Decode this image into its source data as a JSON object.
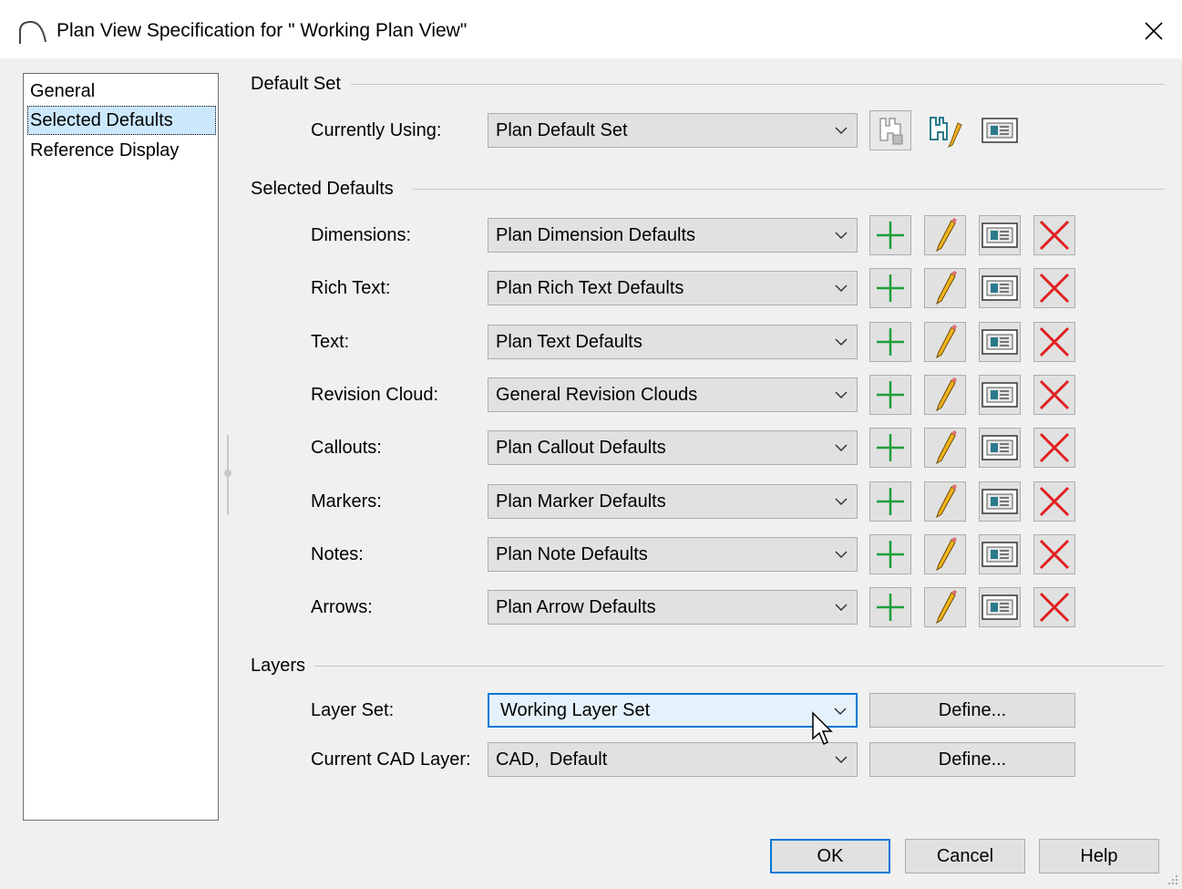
{
  "window": {
    "title": "Plan View Specification for \" Working Plan View\""
  },
  "nav": {
    "items": [
      {
        "label": "General"
      },
      {
        "label": "Selected Defaults"
      },
      {
        "label": "Reference Display"
      }
    ],
    "selected": "Selected Defaults"
  },
  "default_set": {
    "section_title": "Default Set",
    "label": "Currently Using:",
    "value": "Plan Default Set"
  },
  "selected_defaults": {
    "section_title": "Selected Defaults",
    "rows": [
      {
        "label": "Dimensions:",
        "value": "Plan Dimension Defaults"
      },
      {
        "label": "Rich Text:",
        "value": "Plan Rich Text Defaults"
      },
      {
        "label": "Text:",
        "value": "Plan Text Defaults"
      },
      {
        "label": "Revision Cloud:",
        "value": "General Revision Clouds"
      },
      {
        "label": "Callouts:",
        "value": "Plan Callout Defaults"
      },
      {
        "label": "Markers:",
        "value": "Plan Marker Defaults"
      },
      {
        "label": "Notes:",
        "value": "Plan Note Defaults"
      },
      {
        "label": "Arrows:",
        "value": "Plan Arrow Defaults"
      }
    ]
  },
  "layers": {
    "section_title": "Layers",
    "layer_set_label": "Layer Set:",
    "layer_set_value": "Working Layer Set",
    "cad_layer_label": "Current CAD Layer:",
    "cad_layer_value": "CAD,  Default",
    "define_label": "Define..."
  },
  "footer": {
    "ok": "OK",
    "cancel": "Cancel",
    "help": "Help"
  },
  "colors": {
    "accent": "#0078d7",
    "selection": "#cce8ff",
    "add_green": "#1e9e3a",
    "delete_red": "#e02020",
    "pencil": "#f2b320"
  },
  "icons": {
    "add": "plus-icon",
    "edit": "pencil-icon",
    "open": "open-defaults-icon",
    "delete": "delete-x-icon",
    "save_set": "save-default-set-icon",
    "edit_set": "edit-default-set-icon"
  }
}
